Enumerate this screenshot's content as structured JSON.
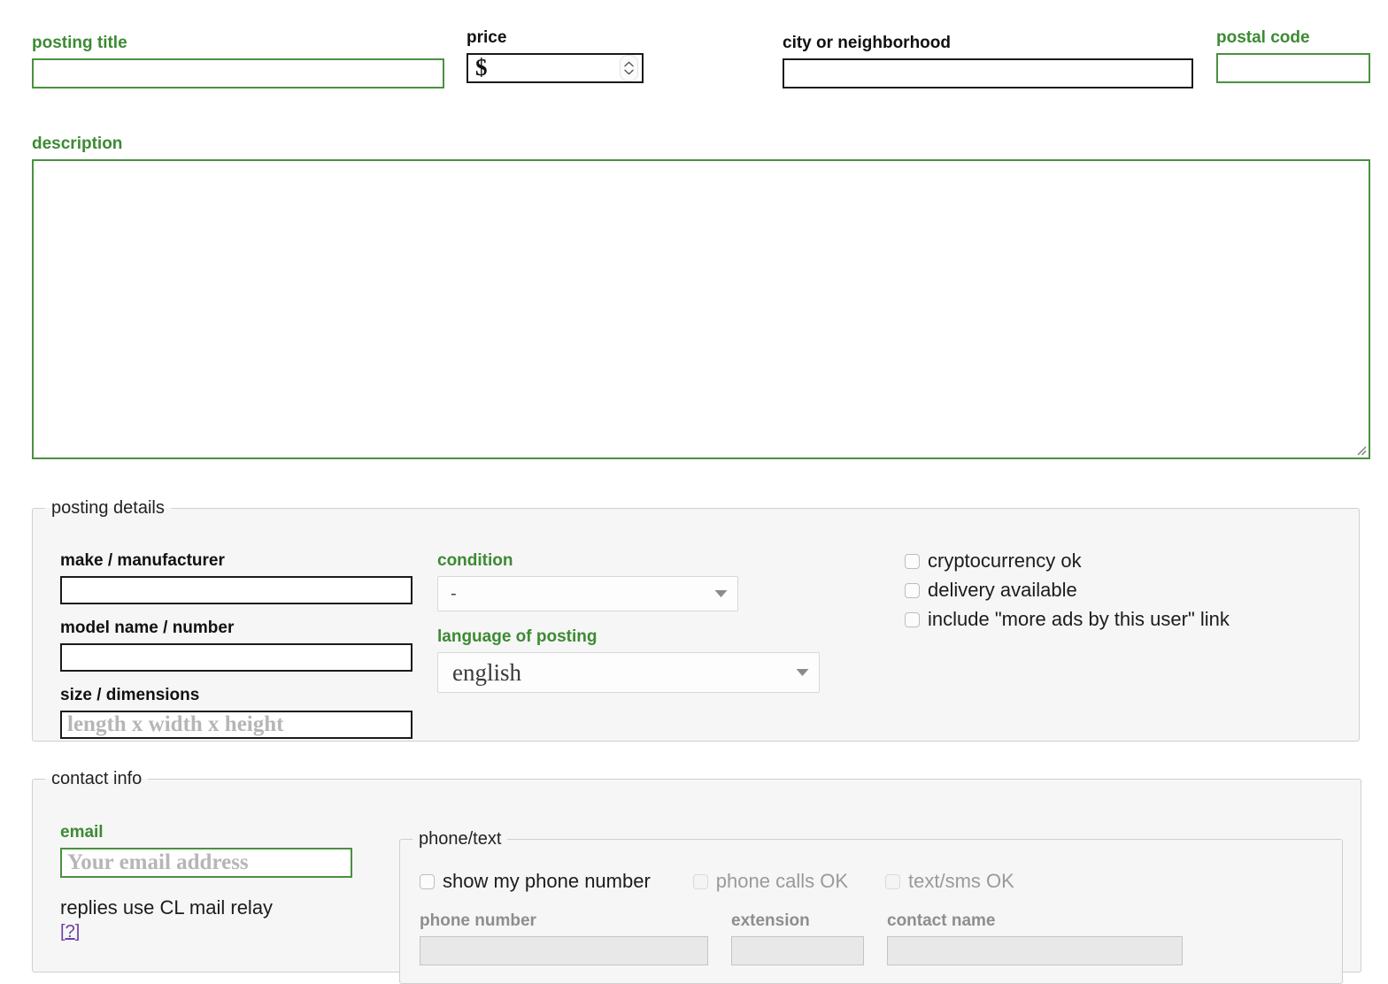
{
  "top_row": {
    "posting_title": {
      "label": "posting title",
      "value": "",
      "placeholder": ""
    },
    "price": {
      "label": "price",
      "currency_symbol": "$",
      "value": "",
      "placeholder": ""
    },
    "city": {
      "label": "city or neighborhood",
      "value": "",
      "placeholder": ""
    },
    "postal_code": {
      "label": "postal code",
      "value": "",
      "placeholder": ""
    }
  },
  "description": {
    "label": "description",
    "value": "",
    "placeholder": ""
  },
  "posting_details": {
    "legend": "posting details",
    "make": {
      "label": "make / manufacturer",
      "value": "",
      "placeholder": ""
    },
    "model": {
      "label": "model name / number",
      "value": "",
      "placeholder": ""
    },
    "size": {
      "label": "size / dimensions",
      "value": "",
      "placeholder": "length x width x height"
    },
    "condition": {
      "label": "condition",
      "selected": "-",
      "options": [
        "-"
      ]
    },
    "language": {
      "label": "language of posting",
      "selected": "english",
      "options": [
        "english"
      ]
    },
    "checkboxes": [
      {
        "label": "cryptocurrency ok",
        "checked": false,
        "disabled": false
      },
      {
        "label": "delivery available",
        "checked": false,
        "disabled": false
      },
      {
        "label": "include \"more ads by this user\" link",
        "checked": false,
        "disabled": false
      }
    ]
  },
  "contact_info": {
    "legend": "contact info",
    "email": {
      "label": "email",
      "value": "",
      "placeholder": "Your email address"
    },
    "relay_note": "replies use CL mail relay",
    "help_link": {
      "open": "[",
      "q": "?",
      "close": "]"
    },
    "phone_text": {
      "legend": "phone/text",
      "checkboxes": [
        {
          "label": "show my phone number",
          "checked": false,
          "disabled": false
        },
        {
          "label": "phone calls OK",
          "checked": false,
          "disabled": true
        },
        {
          "label": "text/sms OK",
          "checked": false,
          "disabled": true
        }
      ],
      "phone_number": {
        "label": "phone number",
        "value": "",
        "placeholder": "",
        "disabled": true
      },
      "extension": {
        "label": "extension",
        "value": "",
        "placeholder": "",
        "disabled": true
      },
      "contact_name": {
        "label": "contact name",
        "value": "",
        "placeholder": "",
        "disabled": true
      }
    }
  },
  "colors": {
    "label_green": "#3c8a33",
    "input_green_border": "#4a9140",
    "link_purple": "#6c3fa0",
    "fieldset_bg": "#f6f6f6",
    "disabled_field_bg": "#e8e8e8",
    "disabled_text": "#9a9a9a"
  }
}
